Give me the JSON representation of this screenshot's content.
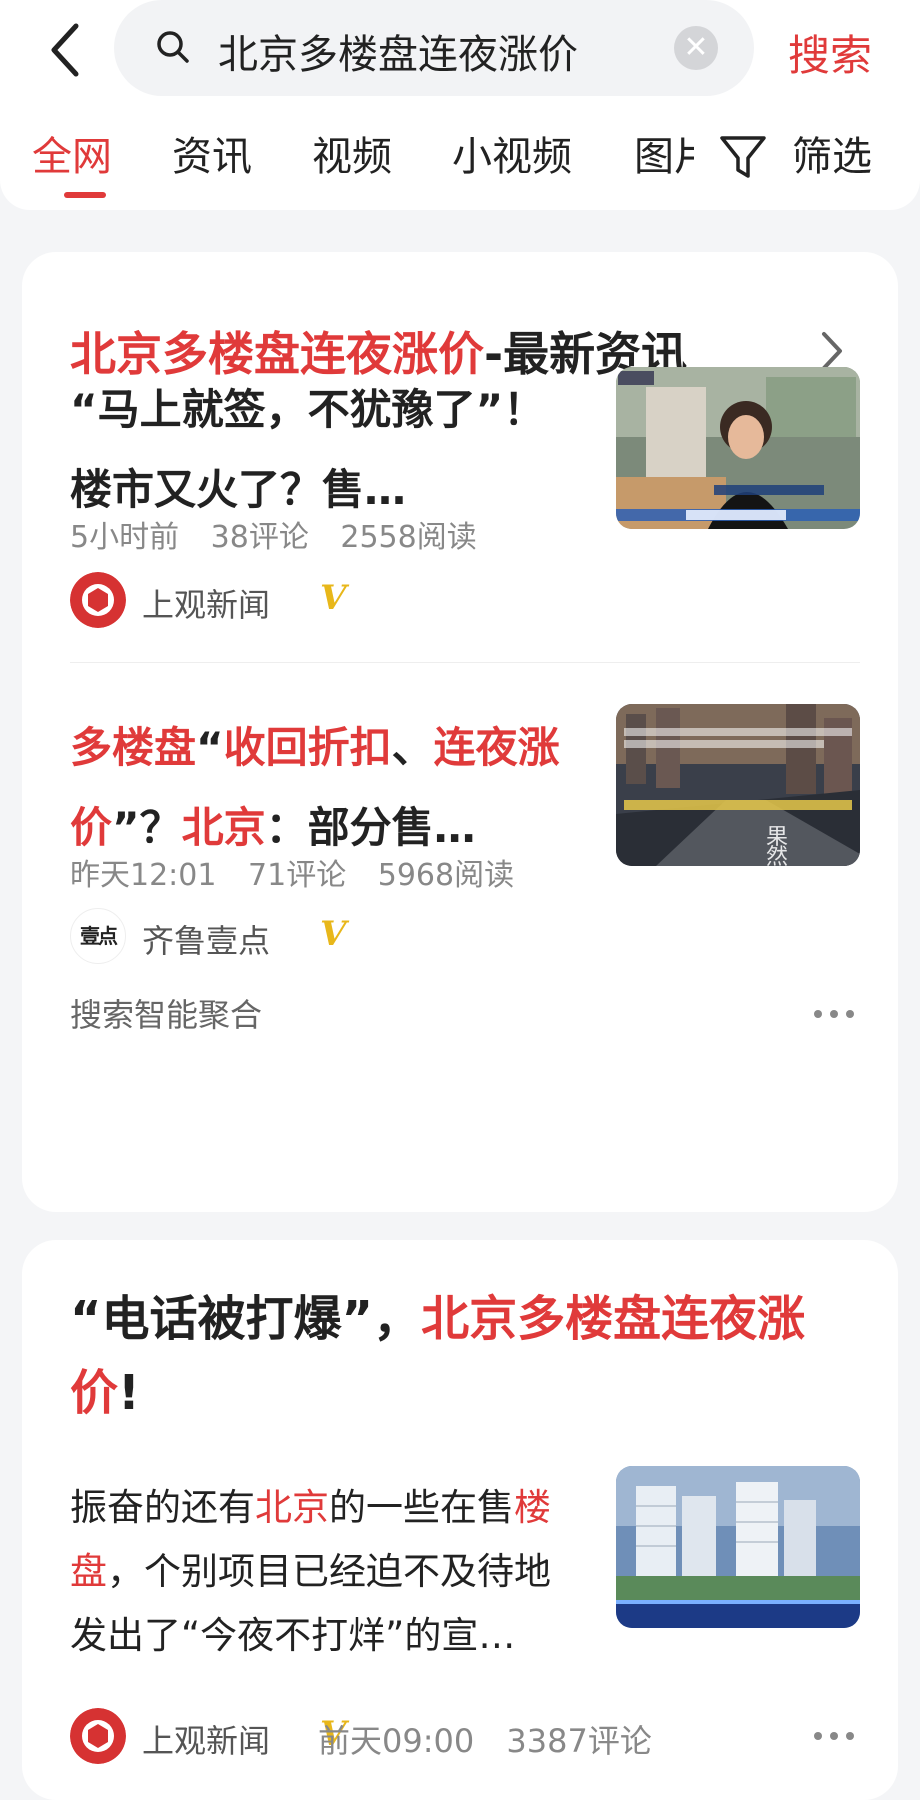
{
  "search": {
    "query": "北京多楼盘连夜涨价",
    "button": "搜索"
  },
  "tabs": [
    {
      "label": "全网",
      "active": true
    },
    {
      "label": "资讯"
    },
    {
      "label": "视频"
    },
    {
      "label": "小视频"
    },
    {
      "label": "图片"
    }
  ],
  "filter_label": "筛选",
  "card1": {
    "title_highlight": "北京多楼盘连夜涨价",
    "title_rest": "-最新资讯",
    "items": [
      {
        "title": "“马上就签，不犹豫了”！楼市又火了？售…",
        "time": "5小时前",
        "comments": "38评论",
        "reads": "2558阅读",
        "source": "上观新闻",
        "badge": "V"
      },
      {
        "title_parts": [
          {
            "text": "多楼盘",
            "hl": true
          },
          {
            "text": "“",
            "hl": false
          },
          {
            "text": "收回折扣",
            "hl": true
          },
          {
            "text": "、",
            "hl": false
          },
          {
            "text": "连夜涨价",
            "hl": true
          },
          {
            "text": "”？",
            "hl": false
          },
          {
            "text": "北京",
            "hl": true
          },
          {
            "text": "：部分售…",
            "hl": false
          }
        ],
        "time": "昨天12:01",
        "comments": "71评论",
        "reads": "5968阅读",
        "source": "齐鲁壹点",
        "source_logo_text": "壹点",
        "badge": "V"
      }
    ],
    "aggregate": "搜索智能聚合"
  },
  "card2": {
    "title_normal": "“电话被打爆”，",
    "title_highlight": "北京多楼盘连夜涨价",
    "title_end": "!",
    "body_parts": [
      {
        "text": "振奋的还有",
        "hl": false
      },
      {
        "text": "北京",
        "hl": true
      },
      {
        "text": "的一些在售",
        "hl": false
      },
      {
        "text": "楼盘",
        "hl": true
      },
      {
        "text": "，个别项目已经迫不及待地发出了“今夜不打烊”的宣…",
        "hl": false
      }
    ],
    "source": "上观新闻",
    "badge": "V",
    "time": "前天09:00",
    "comments": "3387评论"
  },
  "colors": {
    "accent": "#e03a3a",
    "badge": "#e8b71a"
  }
}
